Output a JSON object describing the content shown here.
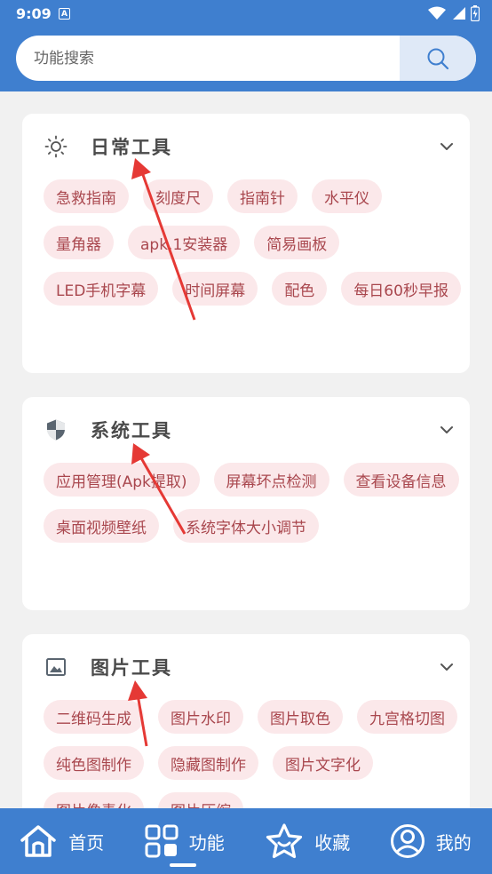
{
  "status": {
    "time": "9:09",
    "notification_letter": "A"
  },
  "search": {
    "placeholder": "功能搜索",
    "icon": "search-icon"
  },
  "sections": [
    {
      "title": "日常工具",
      "icon": "sun-icon",
      "items": [
        "急救指南",
        "刻度尺",
        "指南针",
        "水平仪",
        "量角器",
        "apk.1安装器",
        "简易画板",
        "LED手机字幕",
        "时间屏幕",
        "配色",
        "每日60秒早报"
      ]
    },
    {
      "title": "系统工具",
      "icon": "shield-icon",
      "items": [
        "应用管理(Apk提取)",
        "屏幕坏点检测",
        "查看设备信息",
        "桌面视频壁纸",
        "系统字体大小调节"
      ]
    },
    {
      "title": "图片工具",
      "icon": "image-icon",
      "items": [
        "二维码生成",
        "图片水印",
        "图片取色",
        "九宫格切图",
        "纯色图制作",
        "隐藏图制作",
        "图片文字化",
        "图片像素化",
        "图片压缩"
      ]
    }
  ],
  "nav": [
    {
      "label": "首页",
      "icon": "home-icon"
    },
    {
      "label": "功能",
      "icon": "grid-icon",
      "active": true
    },
    {
      "label": "收藏",
      "icon": "star-icon"
    },
    {
      "label": "我的",
      "icon": "user-icon"
    }
  ],
  "colors": {
    "primary": "#3f7fcf",
    "chip_bg": "#fbe8ea",
    "chip_text": "#a9474e",
    "arrow": "#e53935"
  }
}
